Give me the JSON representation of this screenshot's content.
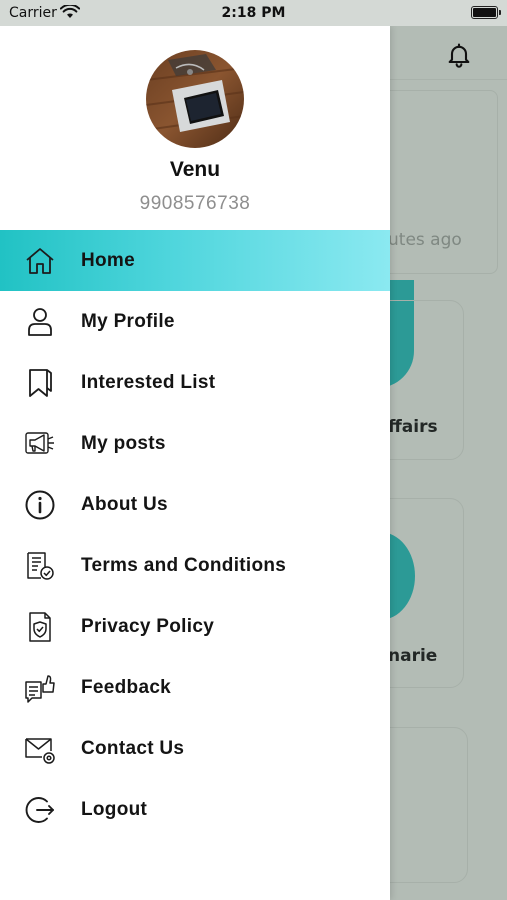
{
  "status_bar": {
    "carrier": "Carrier",
    "time": "2:18 PM"
  },
  "background": {
    "news_time_fragment": "utes ago",
    "category_1_fragment": "ffairs",
    "category_2_fragment": "narie",
    "accent_color": "#2c9a96"
  },
  "profile": {
    "name": "Venu",
    "phone": "9908576738"
  },
  "menu": {
    "active_gradient": [
      "#21c2c4",
      "#8be9f1"
    ],
    "items": [
      {
        "label": "Home",
        "icon": "home-icon",
        "active": true
      },
      {
        "label": "My Profile",
        "icon": "user-icon",
        "active": false
      },
      {
        "label": "Interested List",
        "icon": "bookmark-icon",
        "active": false
      },
      {
        "label": "My posts",
        "icon": "megaphone-icon",
        "active": false
      },
      {
        "label": "About Us",
        "icon": "info-icon",
        "active": false
      },
      {
        "label": "Terms and Conditions",
        "icon": "document-check-icon",
        "active": false
      },
      {
        "label": "Privacy Policy",
        "icon": "shield-document-icon",
        "active": false
      },
      {
        "label": "Feedback",
        "icon": "feedback-thumbs-up-icon",
        "active": false
      },
      {
        "label": "Contact Us",
        "icon": "mail-icon",
        "active": false
      },
      {
        "label": "Logout",
        "icon": "logout-icon",
        "active": false
      }
    ]
  }
}
